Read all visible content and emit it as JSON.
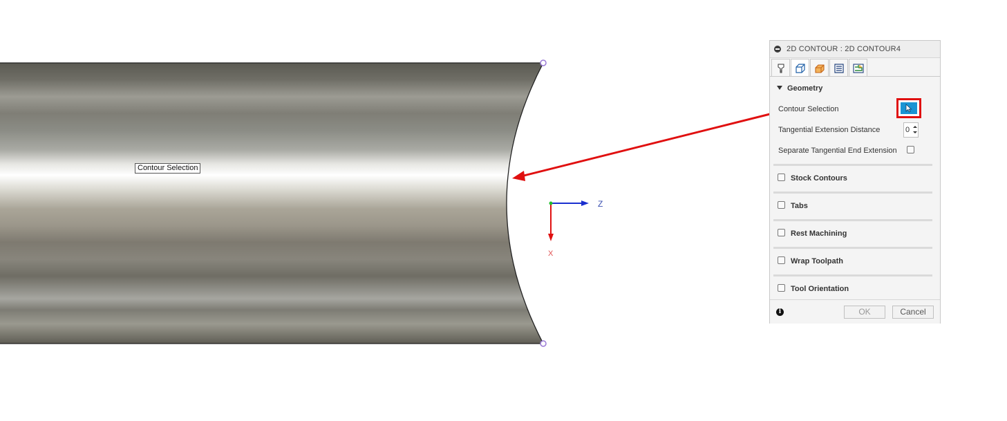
{
  "viewport": {
    "tooltip": "Contour Selection",
    "axis_z_label": "Z",
    "axis_x_label": "X"
  },
  "panel": {
    "title": "2D CONTOUR : 2D CONTOUR4",
    "tabs": [
      {
        "icon": "tool-icon"
      },
      {
        "icon": "geometry-icon"
      },
      {
        "icon": "heights-icon"
      },
      {
        "icon": "passes-icon"
      },
      {
        "icon": "linking-icon"
      }
    ],
    "geometry": {
      "heading": "Geometry",
      "contour_selection_label": "Contour Selection",
      "tangential_extension_label": "Tangential Extension Distance",
      "tangential_extension_value": "0",
      "separate_tangential_label": "Separate Tangential End Extension"
    },
    "sections": [
      {
        "label": "Stock Contours"
      },
      {
        "label": "Tabs"
      },
      {
        "label": "Rest Machining"
      },
      {
        "label": "Wrap Toolpath"
      },
      {
        "label": "Tool Orientation"
      }
    ],
    "footer": {
      "info_glyph": "i",
      "ok_label": "OK",
      "cancel_label": "Cancel"
    }
  },
  "colors": {
    "highlight_red": "#e01010",
    "selection_blue": "#1a94d4",
    "axis_z_blue": "#1a2fcf",
    "axis_x_red": "#e01010"
  }
}
